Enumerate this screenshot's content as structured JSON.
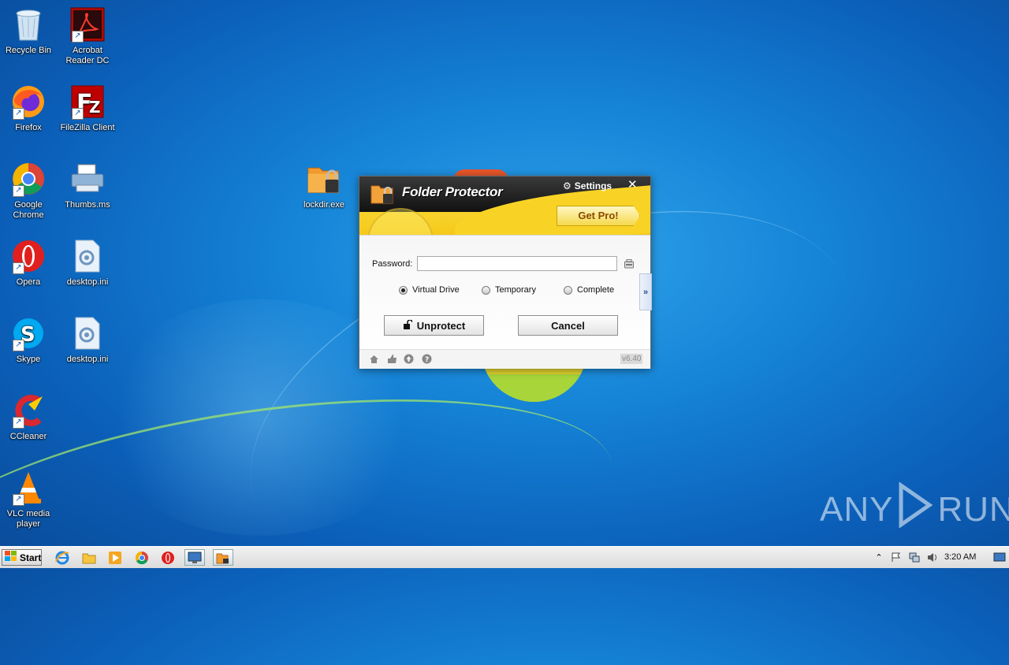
{
  "desktop": {
    "icons": [
      {
        "label": "Recycle Bin"
      },
      {
        "label": "Acrobat Reader DC"
      },
      {
        "label": "Firefox"
      },
      {
        "label": "FileZilla Client"
      },
      {
        "label": "Google Chrome"
      },
      {
        "label": "Thumbs.ms"
      },
      {
        "label": "Opera"
      },
      {
        "label": "desktop.ini"
      },
      {
        "label": "Skype"
      },
      {
        "label": "desktop.ini"
      },
      {
        "label": "CCleaner"
      },
      {
        "label": "VLC media player"
      },
      {
        "label": "lockdir.exe"
      }
    ]
  },
  "dialog": {
    "title": "Folder Protector",
    "settings_label": "Settings",
    "close_label": "✕",
    "get_pro_label": "Get Pro!",
    "password_label": "Password:",
    "password_value": "",
    "modes": [
      {
        "label": "Virtual Drive",
        "selected": true
      },
      {
        "label": "Temporary",
        "selected": false
      },
      {
        "label": "Complete",
        "selected": false
      }
    ],
    "unprotect_label": "Unprotect",
    "cancel_label": "Cancel",
    "side_tab_label": "»",
    "version": "v6.40"
  },
  "watermark": {
    "text_left": "ANY",
    "text_right": "RUN"
  },
  "taskbar": {
    "start_label": "Start",
    "clock": "3:20 AM"
  },
  "colors": {
    "accent_yellow": "#f5c91a",
    "title_dark": "#1a1a1a",
    "get_pro_text": "#8a4a00"
  }
}
